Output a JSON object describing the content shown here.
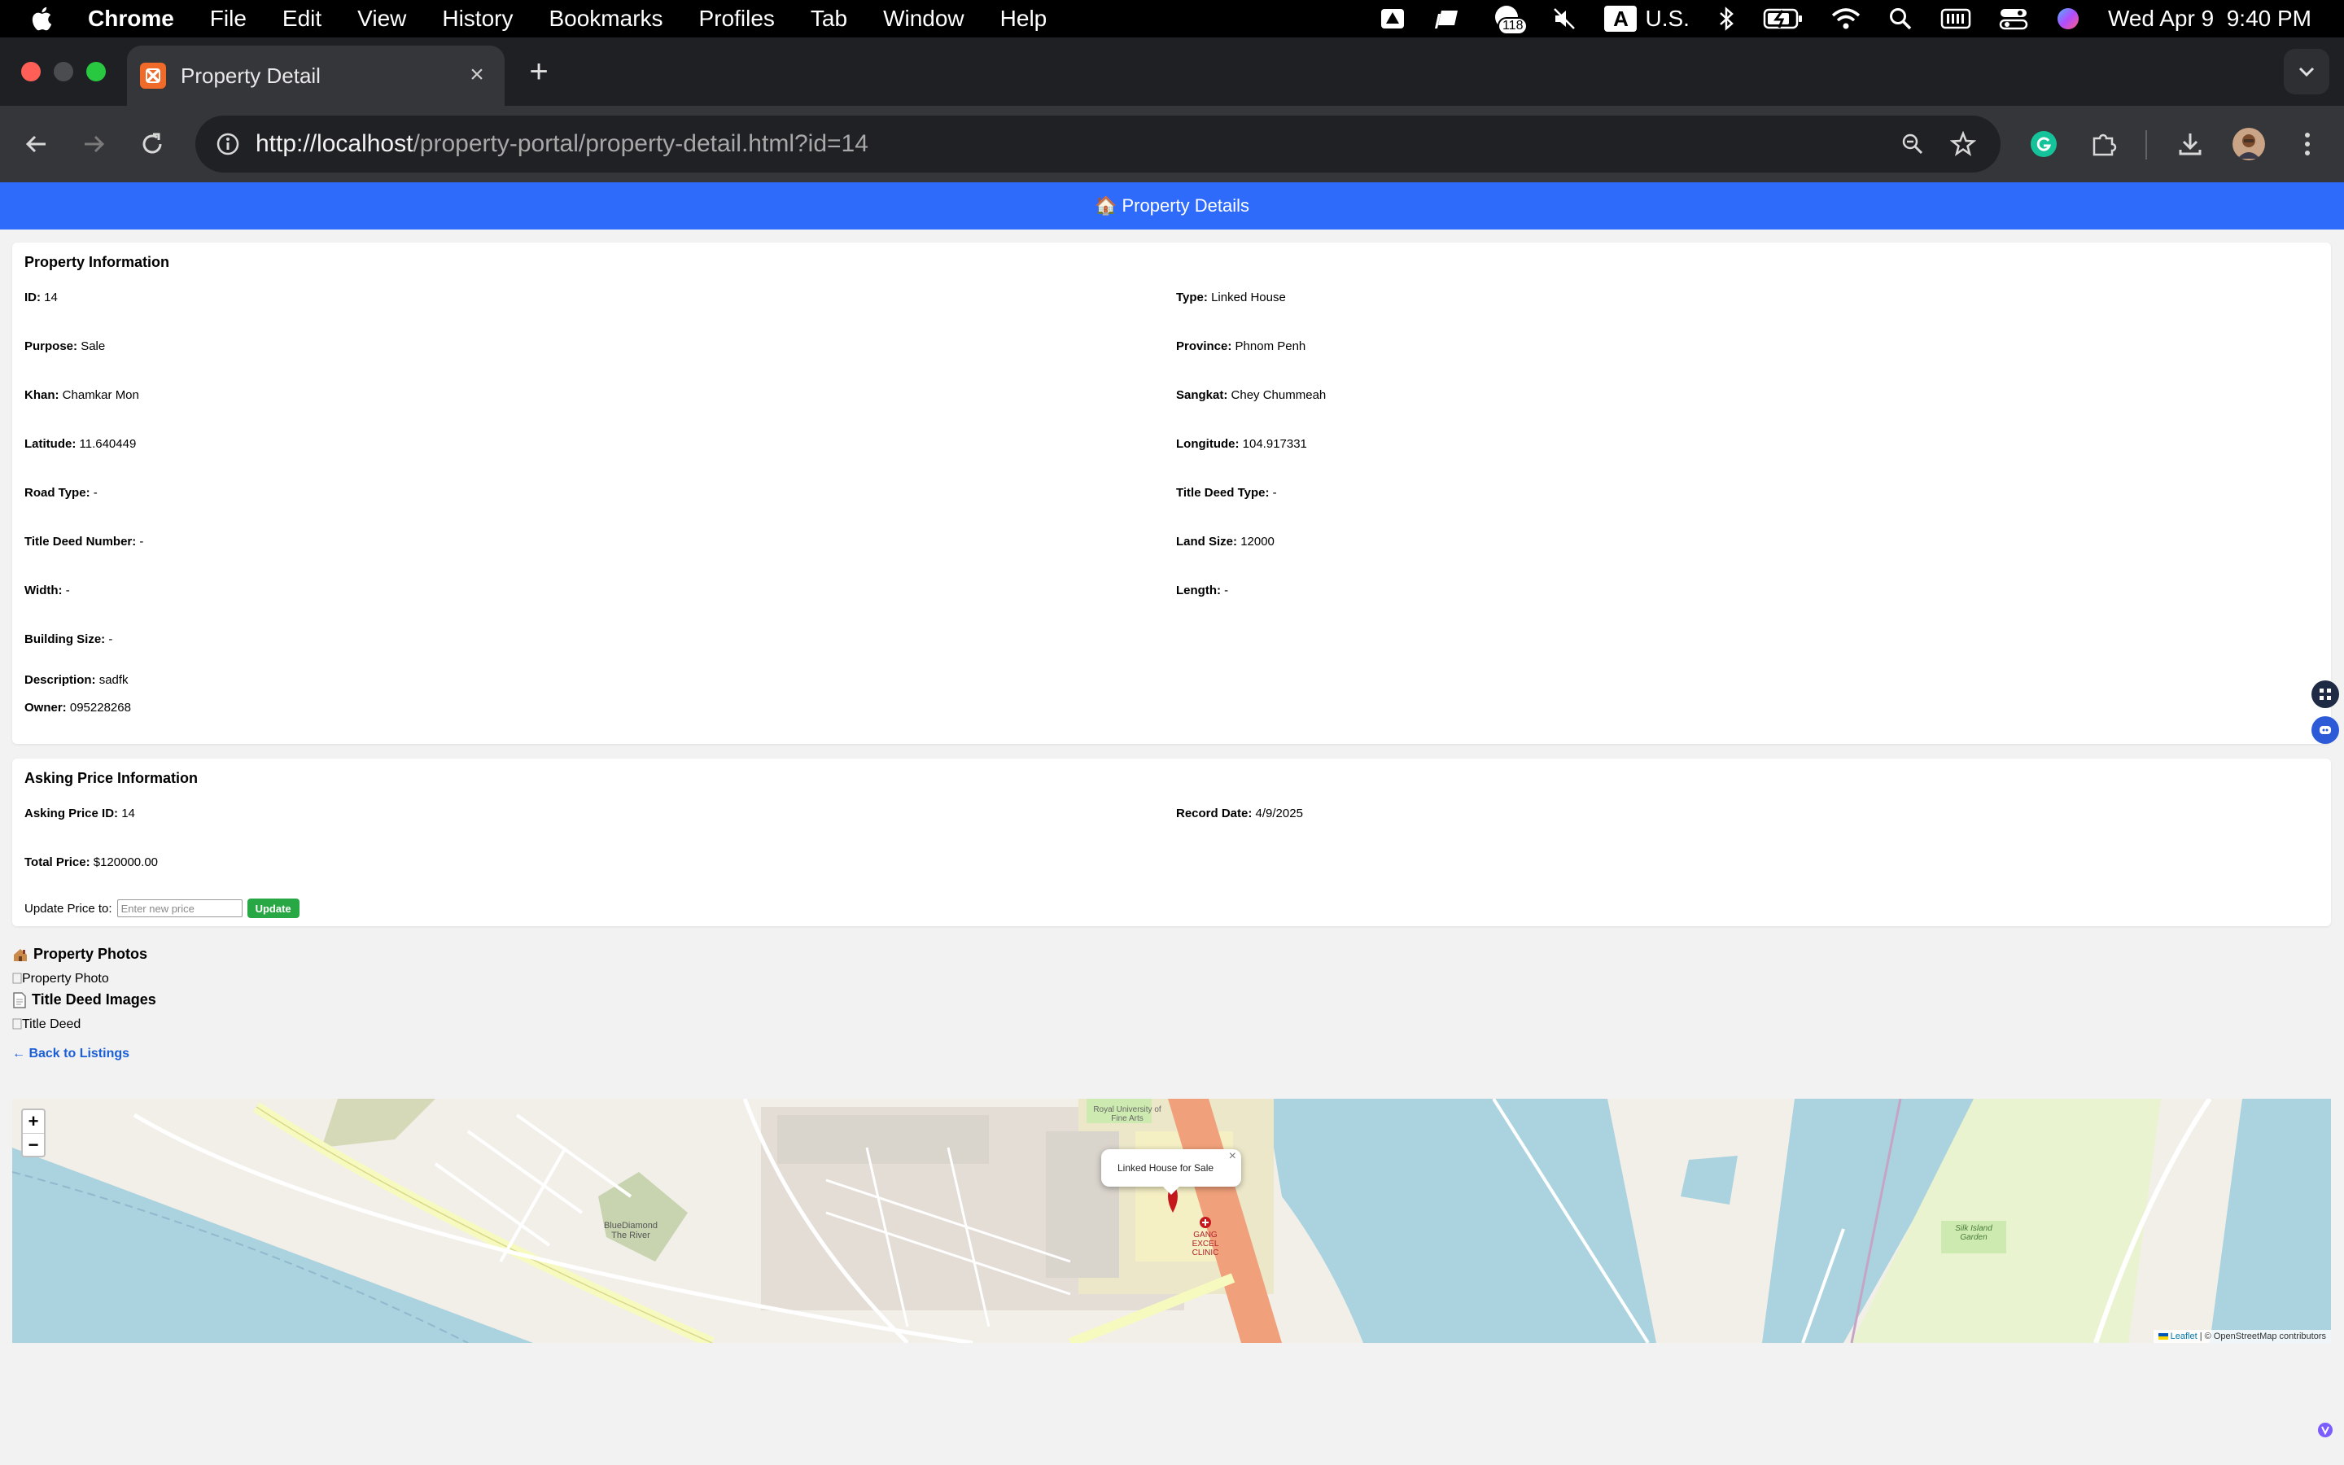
{
  "menubar": {
    "app": "Chrome",
    "items": [
      "File",
      "Edit",
      "View",
      "History",
      "Bookmarks",
      "Profiles",
      "Tab",
      "Window",
      "Help"
    ],
    "badge_count": "118",
    "input_source_letter": "A",
    "input_source": "U.S.",
    "clock": "Wed Apr 9  9:40 PM"
  },
  "browser": {
    "tab_title": "Property Detail",
    "url_host": "http://localhost",
    "url_path": "/property-portal/property-detail.html?id=14"
  },
  "page": {
    "header": "🏠 Property Details",
    "property_info": {
      "title": "Property Information",
      "fields": [
        {
          "label": "ID:",
          "value": "14"
        },
        {
          "label": "Type:",
          "value": "Linked House"
        },
        {
          "label": "Purpose:",
          "value": "Sale"
        },
        {
          "label": "Province:",
          "value": "Phnom Penh"
        },
        {
          "label": "Khan:",
          "value": "Chamkar Mon"
        },
        {
          "label": "Sangkat:",
          "value": "Chey Chummeah"
        },
        {
          "label": "Latitude:",
          "value": "11.640449"
        },
        {
          "label": "Longitude:",
          "value": "104.917331"
        },
        {
          "label": "Road Type:",
          "value": "-"
        },
        {
          "label": "Title Deed Type:",
          "value": "-"
        },
        {
          "label": "Title Deed Number:",
          "value": "-"
        },
        {
          "label": "Land Size:",
          "value": "12000"
        },
        {
          "label": "Width:",
          "value": "-"
        },
        {
          "label": "Length:",
          "value": "-"
        },
        {
          "label": "Building Size:",
          "value": "-"
        }
      ],
      "description_label": "Description:",
      "description_value": "sadfk",
      "owner_label": "Owner:",
      "owner_value": "095228268"
    },
    "asking_price": {
      "title": "Asking Price Information",
      "fields": [
        {
          "label": "Asking Price ID:",
          "value": "14"
        },
        {
          "label": "Record Date:",
          "value": "4/9/2025"
        },
        {
          "label": "Total Price:",
          "value": "$120000.00"
        }
      ],
      "update_label": "Update Price to:",
      "update_placeholder": "Enter new price",
      "update_button": "Update"
    },
    "photos_title": "Property Photos",
    "photo_alt": "Property Photo",
    "title_deed_title": "Title Deed Images",
    "title_deed_alt": "Title Deed",
    "back_link": "← Back to Listings"
  },
  "map": {
    "zoom_in": "+",
    "zoom_out": "−",
    "popup_text": "Linked House for Sale",
    "popup_close": "×",
    "attribution_leaflet": "Leaflet",
    "attribution_osm": "| © OpenStreetMap contributors",
    "labels": {
      "university": "Royal University of Fine Arts",
      "diamond": "BlueDiamond The River",
      "clinic": "GANG EXCEL CLINIC",
      "garden": "Silk Island Garden"
    },
    "colors": {
      "water": "#aad3df",
      "land": "#f2efe9",
      "park": "#cdebb0",
      "road_primary": "#fcd6a4",
      "road_secondary": "#f7fabf",
      "marker": "#c4181d"
    }
  },
  "colors": {
    "header_blue": "#2e6bfb",
    "update_green": "#28a745",
    "link_blue": "#1a5fd8"
  }
}
